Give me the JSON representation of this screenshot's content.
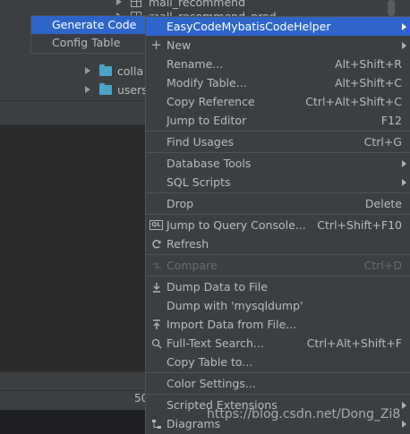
{
  "project_tree": {
    "items": [
      {
        "label": "mall_recommend",
        "icon": "table-icon"
      },
      {
        "label": "mall_recommend_prod",
        "icon": "table-icon"
      },
      {
        "label": "colla",
        "icon": "folder-icon"
      },
      {
        "label": "users",
        "icon": "folder-icon"
      }
    ]
  },
  "status_value": "50",
  "generator_popup": {
    "items": [
      {
        "label": "Generate Code",
        "selected": true
      },
      {
        "label": "Config Table",
        "selected": false
      }
    ]
  },
  "context_menu": {
    "items": {
      "easycode": {
        "label": "EasyCodeMybatisCodeHelper",
        "submenu": true,
        "selected": true
      },
      "new": {
        "label": "New",
        "icon": "plus-icon",
        "submenu": true
      },
      "rename": {
        "label": "Rename...",
        "shortcut": "Alt+Shift+R"
      },
      "modify_table": {
        "label": "Modify Table...",
        "shortcut": "Alt+Shift+C"
      },
      "copy_reference": {
        "label": "Copy Reference",
        "shortcut": "Ctrl+Alt+Shift+C"
      },
      "jump_to_editor": {
        "label": "Jump to Editor",
        "shortcut": "F12"
      },
      "find_usages": {
        "label": "Find Usages",
        "shortcut": "Ctrl+G"
      },
      "database_tools": {
        "label": "Database Tools",
        "submenu": true
      },
      "sql_scripts": {
        "label": "SQL Scripts",
        "submenu": true
      },
      "drop": {
        "label": "Drop",
        "shortcut": "Delete"
      },
      "jump_to_query_console": {
        "label": "Jump to Query Console...",
        "shortcut": "Ctrl+Shift+F10",
        "icon": "query-console-icon",
        "icon_text": "QL"
      },
      "refresh": {
        "label": "Refresh",
        "icon": "refresh-icon"
      },
      "compare": {
        "label": "Compare",
        "shortcut": "Ctrl+D",
        "icon": "compare-icon",
        "disabled": true
      },
      "dump_data_to_file": {
        "label": "Dump Data to File",
        "icon": "dump-icon"
      },
      "dump_with_mysqldump": {
        "label": "Dump with 'mysqldump'"
      },
      "import_data_from_file": {
        "label": "Import Data from File...",
        "icon": "import-icon"
      },
      "full_text_search": {
        "label": "Full-Text Search...",
        "shortcut": "Ctrl+Alt+Shift+F",
        "icon": "search-icon"
      },
      "copy_table_to": {
        "label": "Copy Table to..."
      },
      "color_settings": {
        "label": "Color Settings..."
      },
      "scripted_extensions": {
        "label": "Scripted Extensions",
        "submenu": true
      },
      "diagrams": {
        "label": "Diagrams",
        "submenu": true,
        "icon": "diagram-icon"
      }
    }
  },
  "watermark": "https://blog.csdn.net/Dong_Zi8",
  "colors": {
    "menu_bg": "#3c3f41",
    "selection": "#2f65ca",
    "text": "#bbbbbb",
    "disabled_text": "#6b6b6b",
    "editor_bg": "#2b2b2b",
    "folder": "#4aa3c8"
  }
}
